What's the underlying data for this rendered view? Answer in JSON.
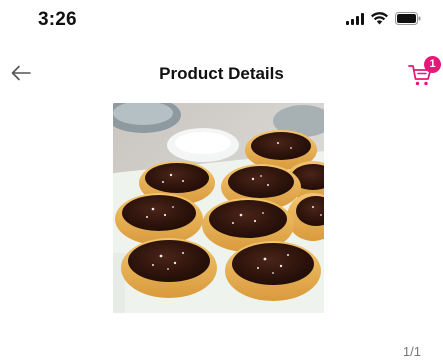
{
  "status_bar": {
    "time": "3:26"
  },
  "header": {
    "title": "Product Details",
    "cart_count": "1",
    "accent_color": "#e6187a"
  },
  "gallery": {
    "image_subject": "chocolate-tarts",
    "counter": "1/1"
  },
  "icons": {
    "back": "arrow-left-icon",
    "cart": "shopping-cart-icon",
    "signal": "signal-icon",
    "wifi": "wifi-icon",
    "battery": "battery-icon"
  }
}
